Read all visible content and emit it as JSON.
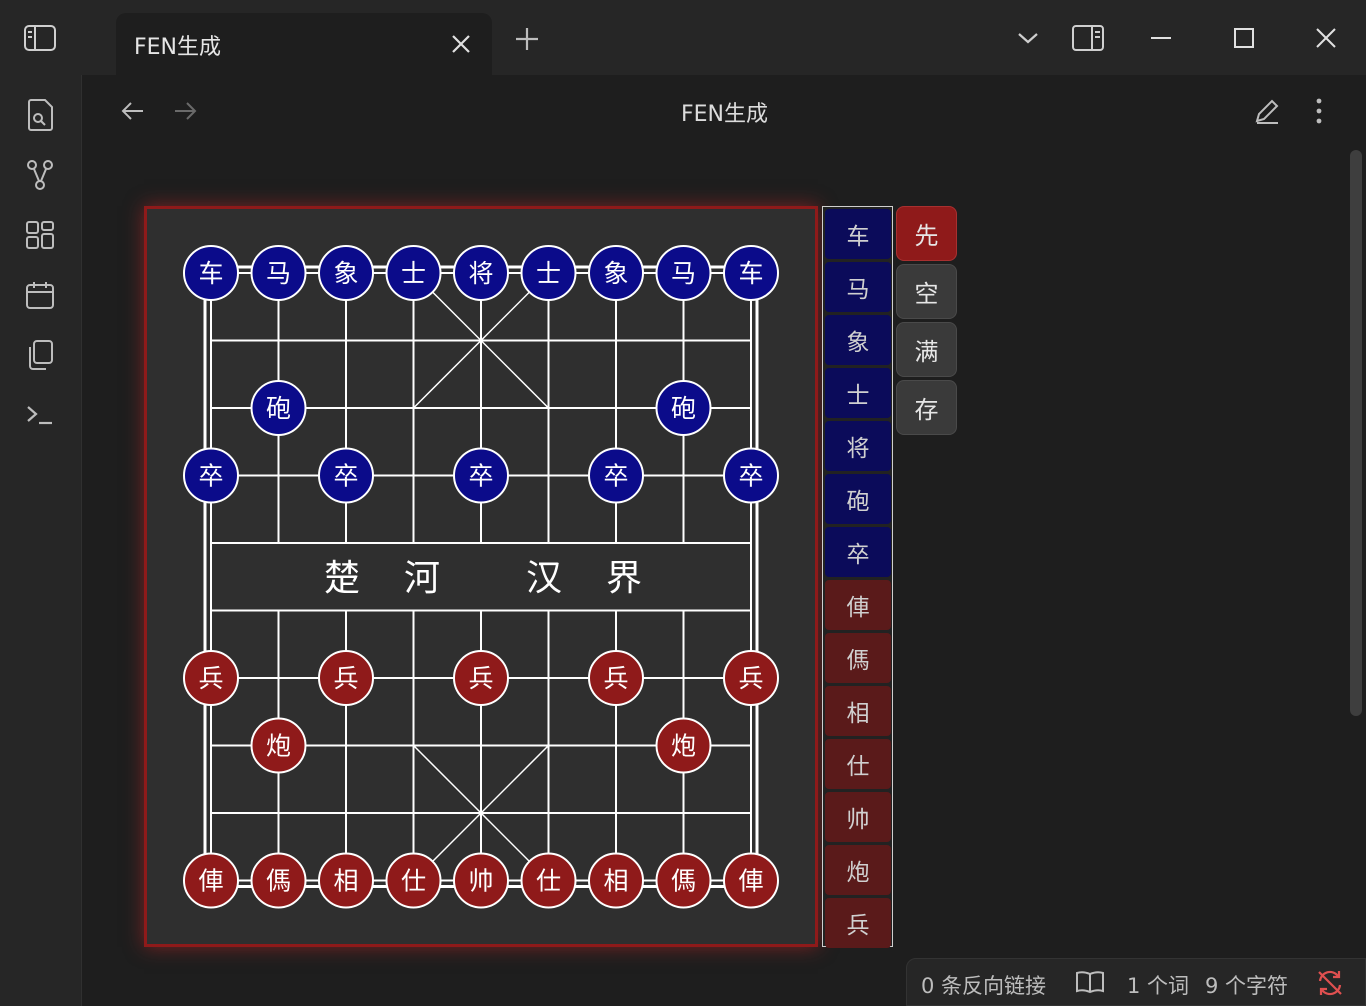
{
  "titlebar": {
    "tab_title": "FEN生成",
    "icons": [
      "sidebar-toggle-icon",
      "close-icon",
      "plus-icon",
      "chevron-down-icon",
      "split-view-icon",
      "minimize-icon",
      "maximize-icon",
      "close-window-icon"
    ]
  },
  "ribbon": {
    "items": [
      "open-file-icon",
      "graph-icon",
      "canvas-icon",
      "calendar-icon",
      "copy-icon",
      "terminal-icon"
    ]
  },
  "header": {
    "title": "FEN生成",
    "icons": [
      "back-arrow-icon",
      "forward-arrow-icon",
      "edit-icon",
      "more-options-icon"
    ]
  },
  "board": {
    "river": [
      "楚",
      "河",
      "汉",
      "界"
    ],
    "colors": {
      "black": "#0b0b8a",
      "red": "#8f1a1a",
      "frame": "#8f1a1a"
    },
    "pieces": [
      {
        "label": "车",
        "side": "black",
        "file": 0,
        "rank": 0
      },
      {
        "label": "马",
        "side": "black",
        "file": 1,
        "rank": 0
      },
      {
        "label": "象",
        "side": "black",
        "file": 2,
        "rank": 0
      },
      {
        "label": "士",
        "side": "black",
        "file": 3,
        "rank": 0
      },
      {
        "label": "将",
        "side": "black",
        "file": 4,
        "rank": 0
      },
      {
        "label": "士",
        "side": "black",
        "file": 5,
        "rank": 0
      },
      {
        "label": "象",
        "side": "black",
        "file": 6,
        "rank": 0
      },
      {
        "label": "马",
        "side": "black",
        "file": 7,
        "rank": 0
      },
      {
        "label": "车",
        "side": "black",
        "file": 8,
        "rank": 0
      },
      {
        "label": "砲",
        "side": "black",
        "file": 1,
        "rank": 2
      },
      {
        "label": "砲",
        "side": "black",
        "file": 7,
        "rank": 2
      },
      {
        "label": "卒",
        "side": "black",
        "file": 0,
        "rank": 3
      },
      {
        "label": "卒",
        "side": "black",
        "file": 2,
        "rank": 3
      },
      {
        "label": "卒",
        "side": "black",
        "file": 4,
        "rank": 3
      },
      {
        "label": "卒",
        "side": "black",
        "file": 6,
        "rank": 3
      },
      {
        "label": "卒",
        "side": "black",
        "file": 8,
        "rank": 3
      },
      {
        "label": "兵",
        "side": "red",
        "file": 0,
        "rank": 6
      },
      {
        "label": "兵",
        "side": "red",
        "file": 2,
        "rank": 6
      },
      {
        "label": "兵",
        "side": "red",
        "file": 4,
        "rank": 6
      },
      {
        "label": "兵",
        "side": "red",
        "file": 6,
        "rank": 6
      },
      {
        "label": "兵",
        "side": "red",
        "file": 8,
        "rank": 6
      },
      {
        "label": "炮",
        "side": "red",
        "file": 1,
        "rank": 7
      },
      {
        "label": "炮",
        "side": "red",
        "file": 7,
        "rank": 7
      },
      {
        "label": "俥",
        "side": "red",
        "file": 0,
        "rank": 9
      },
      {
        "label": "傌",
        "side": "red",
        "file": 1,
        "rank": 9
      },
      {
        "label": "相",
        "side": "red",
        "file": 2,
        "rank": 9
      },
      {
        "label": "仕",
        "side": "red",
        "file": 3,
        "rank": 9
      },
      {
        "label": "帅",
        "side": "red",
        "file": 4,
        "rank": 9
      },
      {
        "label": "仕",
        "side": "red",
        "file": 5,
        "rank": 9
      },
      {
        "label": "相",
        "side": "red",
        "file": 6,
        "rank": 9
      },
      {
        "label": "傌",
        "side": "red",
        "file": 7,
        "rank": 9
      },
      {
        "label": "俥",
        "side": "red",
        "file": 8,
        "rank": 9
      }
    ]
  },
  "palette": {
    "black": [
      "车",
      "马",
      "象",
      "士",
      "将",
      "砲",
      "卒"
    ],
    "red": [
      "俥",
      "傌",
      "相",
      "仕",
      "帅",
      "炮",
      "兵"
    ]
  },
  "controls": [
    {
      "label": "先",
      "active": true
    },
    {
      "label": "空",
      "active": false
    },
    {
      "label": "满",
      "active": false
    },
    {
      "label": "存",
      "active": false
    }
  ],
  "status": {
    "backlinks": "0 条反向链接",
    "words": "1 个词",
    "chars": "9 个字符",
    "icons": [
      "reading-view-icon",
      "sync-error-icon"
    ]
  }
}
